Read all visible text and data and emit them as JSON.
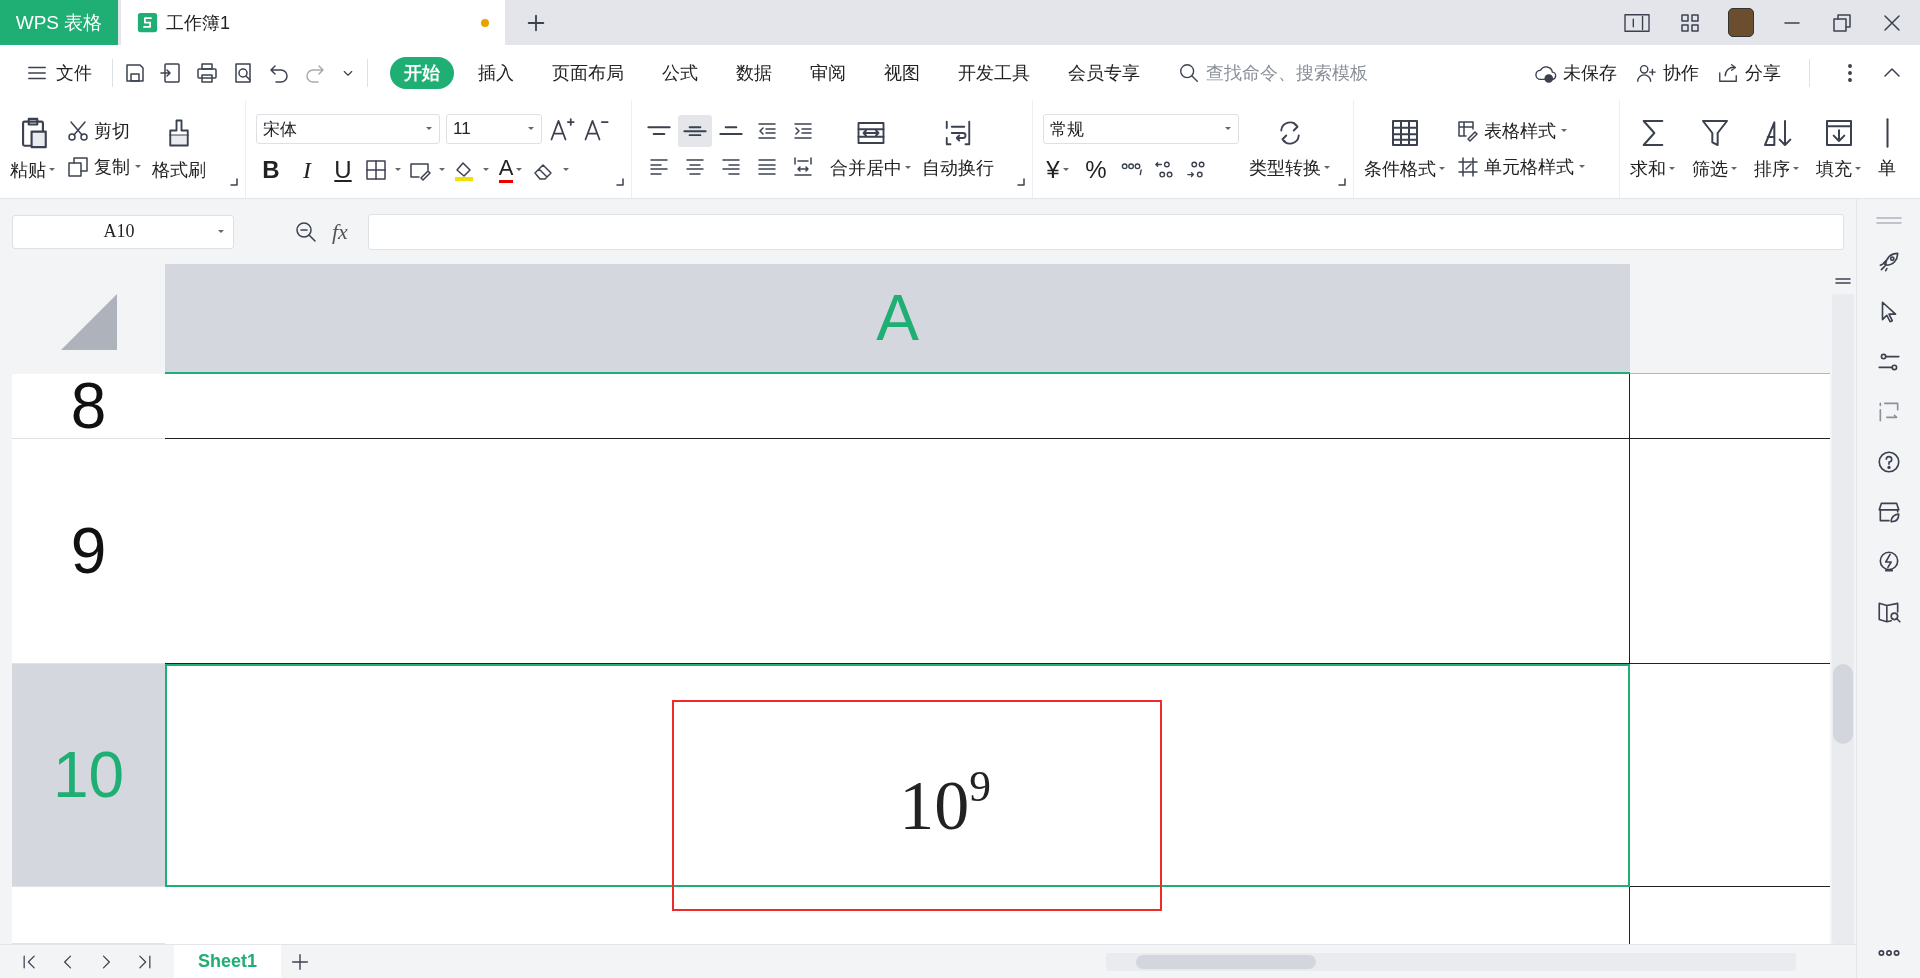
{
  "app_tab": "WPS 表格",
  "doc_tab": {
    "title": "工作簿1",
    "unsaved": true
  },
  "menu": {
    "file": "文件",
    "tabs": [
      {
        "label": "开始",
        "selected": true
      },
      {
        "label": "插入",
        "selected": false
      },
      {
        "label": "页面布局",
        "selected": false
      },
      {
        "label": "公式",
        "selected": false
      },
      {
        "label": "数据",
        "selected": false
      },
      {
        "label": "审阅",
        "selected": false
      },
      {
        "label": "视图",
        "selected": false
      },
      {
        "label": "开发工具",
        "selected": false
      },
      {
        "label": "会员专享",
        "selected": false
      }
    ],
    "search": {
      "placeholder": "查找命令、搜索模板"
    },
    "actions": [
      "未保存",
      "协作",
      "分享"
    ]
  },
  "ribbon": {
    "paste": "粘贴",
    "cut": "剪切",
    "copy": "复制",
    "format_painter": "格式刷",
    "font": {
      "name": "宋体",
      "size": "11",
      "bold": "B",
      "italic": "I",
      "underline": "U",
      "font_color_glyph": "A"
    },
    "align_buttons": [
      {
        "selected": false
      },
      {
        "selected": true
      },
      {
        "selected": false
      },
      {
        "selected": false
      },
      {
        "selected": false
      },
      {
        "selected": false
      },
      {
        "selected": false
      },
      {
        "selected": false
      },
      {
        "selected": false
      },
      {
        "selected": false
      }
    ],
    "merge": "合并居中",
    "wrap": "自动换行",
    "number": {
      "format": "常规",
      "currency": "¥",
      "percent": "%",
      "convert": "类型转换"
    },
    "conditional": "条件格式",
    "table_style": "表格样式",
    "cell_style": "单元格样式",
    "editing": [
      "求和",
      "筛选",
      "排序",
      "填充",
      "单"
    ]
  },
  "formula_bar": {
    "cell_ref": "A10",
    "fx": "fx"
  },
  "grid": {
    "columns": [
      {
        "label": "A",
        "selected": true
      }
    ],
    "rows": [
      {
        "label": "8",
        "selected": false
      },
      {
        "label": "9",
        "selected": false
      },
      {
        "label": "10",
        "selected": true,
        "value": "10$^{9}$"
      }
    ]
  },
  "sheets": [
    {
      "label": "Sheet1",
      "selected": true
    }
  ]
}
